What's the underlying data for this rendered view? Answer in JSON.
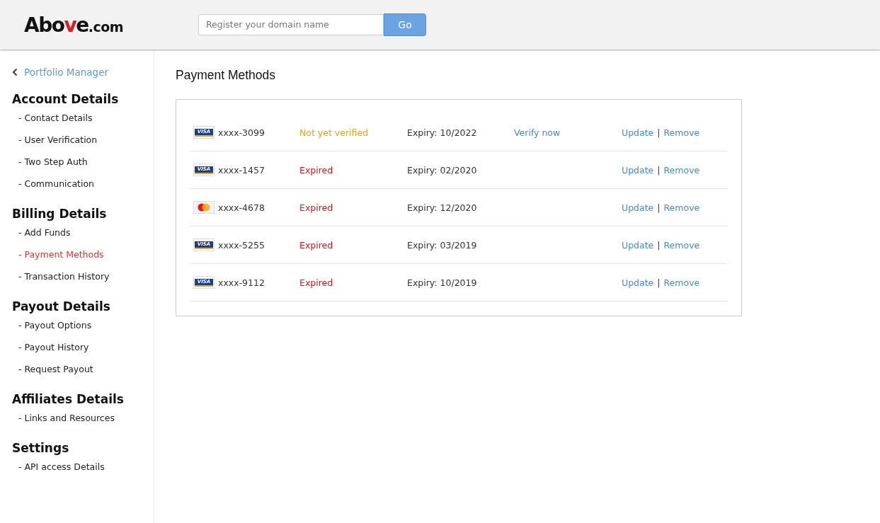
{
  "header": {
    "logo": [
      {
        "text": "Abo",
        "accent": false,
        "small": false
      },
      {
        "text": "v",
        "accent": true,
        "small": false
      },
      {
        "text": "e",
        "accent": false,
        "small": false
      },
      {
        "text": ".com",
        "accent": false,
        "small": true
      }
    ],
    "search": {
      "placeholder": "Register your domain name"
    },
    "go_button": "Go"
  },
  "sidebar": {
    "back_link": "Portfolio Manager",
    "sections": [
      {
        "title": "Account Details",
        "items": [
          {
            "label": "- Contact Details",
            "selected": false
          },
          {
            "label": "- User Verification",
            "selected": false
          },
          {
            "label": "- Two Step Auth",
            "selected": false
          },
          {
            "label": "- Communication",
            "selected": false
          }
        ]
      },
      {
        "title": "Billing Details",
        "items": [
          {
            "label": "- Add Funds",
            "selected": false
          },
          {
            "label": "- Payment Methods",
            "selected": true
          },
          {
            "label": "- Transaction History",
            "selected": false
          }
        ]
      },
      {
        "title": "Payout Details",
        "items": [
          {
            "label": "- Payout Options",
            "selected": false
          },
          {
            "label": "- Payout History",
            "selected": false
          },
          {
            "label": "- Request Payout",
            "selected": false
          }
        ]
      },
      {
        "title": "Affiliates Details",
        "items": [
          {
            "label": "- Links and Resources",
            "selected": false
          }
        ]
      },
      {
        "title": "Settings",
        "items": [
          {
            "label": "- API access Details",
            "selected": false
          }
        ]
      }
    ]
  },
  "page_title": "Payment Methods",
  "cards": [
    {
      "kind": "visa",
      "brand_label": "VISA",
      "number": "xxxx-3099",
      "status": {
        "text": "Not yet verified",
        "kind": "pending"
      },
      "expiry": "Expiry: 10/2022",
      "verify_link": "Verify now",
      "update": "Update",
      "separator": "|",
      "remove": "Remove"
    },
    {
      "kind": "visa",
      "brand_label": "VISA",
      "number": "xxxx-1457",
      "status": {
        "text": "Expired",
        "kind": "expired"
      },
      "expiry": "Expiry: 02/2020",
      "update": "Update",
      "separator": "|",
      "remove": "Remove"
    },
    {
      "kind": "mastercard",
      "number": "xxxx-4678",
      "status": {
        "text": "Expired",
        "kind": "expired"
      },
      "expiry": "Expiry: 12/2020",
      "update": "Update",
      "separator": "|",
      "remove": "Remove"
    },
    {
      "kind": "visa",
      "brand_label": "VISA",
      "number": "xxxx-5255",
      "status": {
        "text": "Expired",
        "kind": "expired"
      },
      "expiry": "Expiry: 03/2019",
      "update": "Update",
      "separator": "|",
      "remove": "Remove"
    },
    {
      "kind": "visa",
      "brand_label": "VISA",
      "number": "xxxx-9112",
      "status": {
        "text": "Expired",
        "kind": "expired"
      },
      "expiry": "Expiry: 10/2019",
      "update": "Update",
      "separator": "|",
      "remove": "Remove"
    }
  ]
}
